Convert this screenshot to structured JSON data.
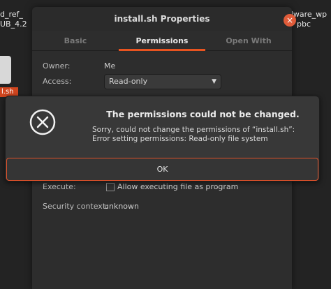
{
  "desktop": {
    "left_label_line1": "d_ref_",
    "left_label_line2": "UB_4.2",
    "left_selected_label": "l.sh",
    "right_label_line1": "ardware_wp",
    "right_label_line2": "pbc"
  },
  "properties": {
    "title": "install.sh Properties",
    "close_symbol": "×",
    "tabs": [
      {
        "label": "Basic"
      },
      {
        "label": "Permissions"
      },
      {
        "label": "Open With"
      }
    ],
    "owner_label": "Owner:",
    "owner_value": "Me",
    "access_label": "Access:",
    "access_value": "Read-only",
    "dropdown_arrow": "▼",
    "execute_label": "Execute:",
    "execute_option": "Allow executing file as program",
    "execute_checked": false,
    "security_label": "Security context:",
    "security_value": "unknown"
  },
  "dialog": {
    "title": "The permissions could not be changed.",
    "message": "Sorry, could not change the permissions of “install.sh”: Error setting permissions: Read-only file system",
    "ok_label": "OK"
  },
  "colors": {
    "accent": "#e95420",
    "close_button": "#e05c3a",
    "window_bg": "#2d2d2d",
    "dialog_bg": "#383838"
  }
}
